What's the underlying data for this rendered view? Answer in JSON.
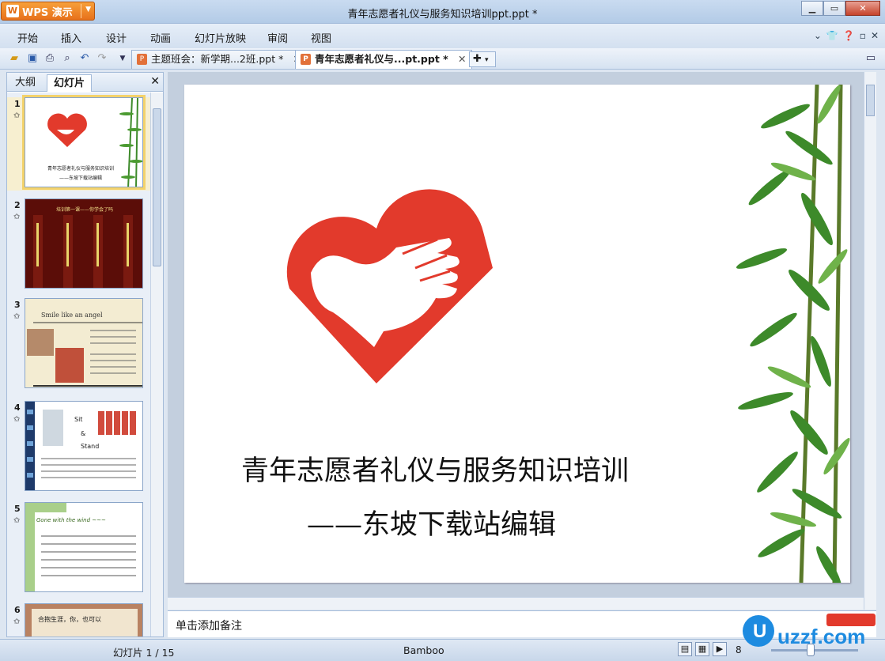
{
  "app": {
    "button_label": "WPS 演示",
    "window_title": "青年志愿者礼仪与服务知识培训ppt.ppt *"
  },
  "menu": [
    "开始",
    "插入",
    "设计",
    "动画",
    "幻灯片放映",
    "审阅",
    "视图"
  ],
  "tabs": [
    {
      "label": "主题班会：新学期...2班.ppt *",
      "active": false
    },
    {
      "label": "青年志愿者礼仪与...pt.ppt *",
      "active": true
    }
  ],
  "left_panel": {
    "tabs": [
      "大纲",
      "幻灯片"
    ],
    "active_tab": "幻灯片",
    "thumbnails": [
      {
        "num": "1",
        "line1": "青年志愿者礼仪与服务知识培训",
        "line2": "——东坡下载站编辑"
      },
      {
        "num": "2",
        "line1": "培训第一课——你学会了吗"
      },
      {
        "num": "3",
        "line1": "Smile like an angel"
      },
      {
        "num": "4",
        "line1": "Sit",
        "line2": "&",
        "line3": "Stand"
      },
      {
        "num": "5",
        "line1": "Gone with the wind ~~~"
      },
      {
        "num": "6",
        "line1": "合抱生涯，你，也可以"
      }
    ]
  },
  "slide": {
    "title": "青年志愿者礼仪与服务知识培训",
    "subtitle": "——东坡下载站编辑"
  },
  "notes_placeholder": "单击添加备注",
  "status": {
    "slide_indicator": "幻灯片 1 / 15",
    "theme": "Bamboo",
    "zoom": "8"
  },
  "watermark": "uzzf.com",
  "colors": {
    "logo_red": "#e23a2c",
    "bamboo_green": "#3d8a2a",
    "accent_orange": "#e7711b"
  }
}
